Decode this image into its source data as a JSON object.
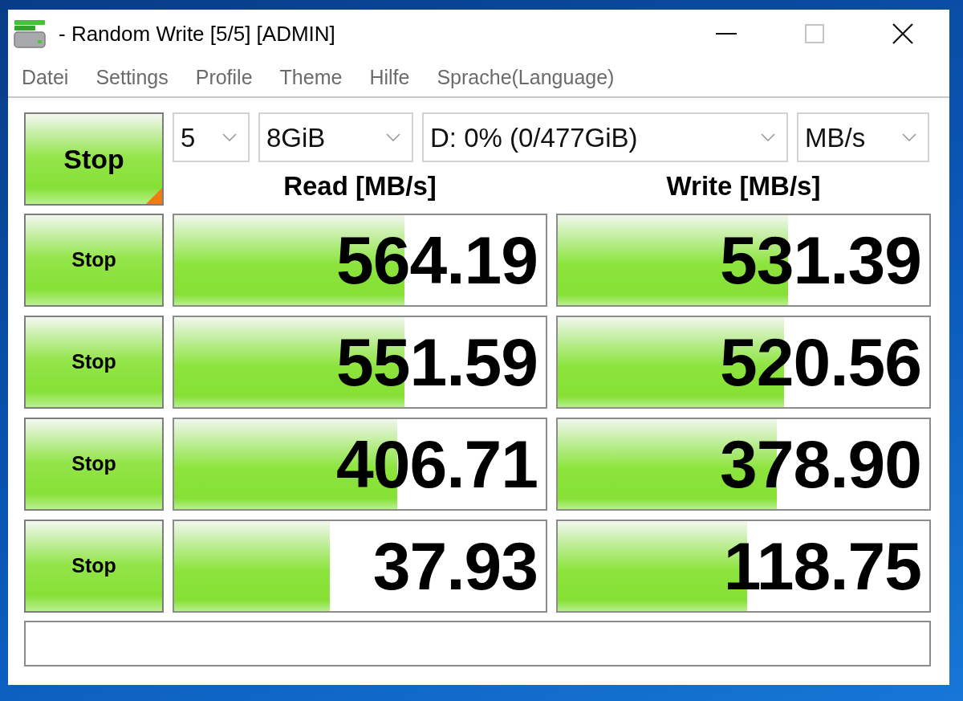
{
  "window": {
    "title": "- Random Write [5/5] [ADMIN]",
    "controls": [
      {
        "kind": "minimize",
        "disabled": false
      },
      {
        "kind": "maximize",
        "disabled": true
      },
      {
        "kind": "close",
        "disabled": false
      }
    ]
  },
  "menu": [
    "Datei",
    "Settings",
    "Profile",
    "Theme",
    "Hilfe",
    "Sprache(Language)"
  ],
  "toolbar": {
    "main_button": "Stop",
    "selects": [
      {
        "kind": "count",
        "value": "5"
      },
      {
        "kind": "size",
        "value": "8GiB"
      },
      {
        "kind": "drive",
        "value": "D: 0% (0/477GiB)"
      },
      {
        "kind": "unit",
        "value": "MB/s"
      }
    ]
  },
  "columns": [
    "Read [MB/s]",
    "Write [MB/s]"
  ],
  "rows": [
    {
      "button": "Stop",
      "read": {
        "value": "564.19",
        "level": 0.62
      },
      "write": {
        "value": "531.39",
        "level": 0.62
      }
    },
    {
      "button": "Stop",
      "read": {
        "value": "551.59",
        "level": 0.62
      },
      "write": {
        "value": "520.56",
        "level": 0.61
      }
    },
    {
      "button": "Stop",
      "read": {
        "value": "406.71",
        "level": 0.6
      },
      "write": {
        "value": "378.90",
        "level": 0.59
      }
    },
    {
      "button": "Stop",
      "read": {
        "value": "37.93",
        "level": 0.42
      },
      "write": {
        "value": "118.75",
        "level": 0.51
      }
    }
  ]
}
